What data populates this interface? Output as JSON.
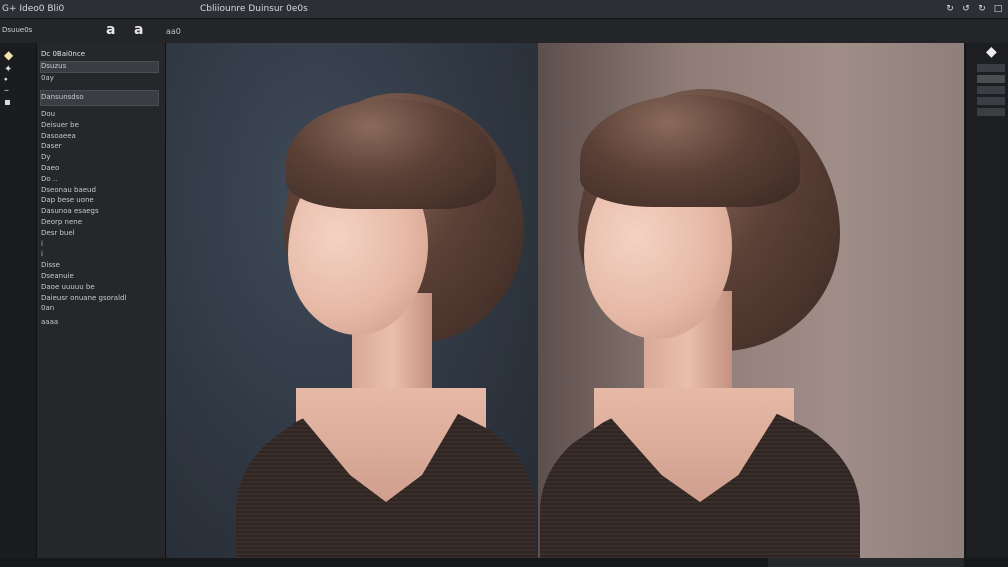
{
  "titlebar": {
    "app_title": "G+ Ideo0 Bli0",
    "document_title": "Cbliiounre Duinsur 0e0s",
    "controls": [
      "↻",
      "↺",
      "↻",
      "□"
    ]
  },
  "toolbar": {
    "left_label": "Dsuue0s",
    "tool_a": "a",
    "tool_b": "a",
    "tool_c": "aa0"
  },
  "left_panel": {
    "header": "Dc 0Bai0nce",
    "field_1": "Dsuzus",
    "row_1": "0ay",
    "field_2": "Dansunsdso",
    "lines": [
      "Dou",
      "Deisuer be",
      "Dasoaeea",
      "Daser",
      "Dy",
      "Daeo",
      "Do ..",
      "Dseonau baeud",
      "Dap bese uone",
      "Dasunoa esaegs",
      "Deorp nene",
      "Desr buel",
      "i",
      "i",
      "Disse",
      "Dseanuie",
      "Daoe uuuuu be",
      "Daieusr onuane gsoraldl",
      "0an",
      "aaaa"
    ]
  },
  "left_tools": [
    "◆",
    "✦",
    "⬩",
    "–",
    "▪"
  ],
  "right_panel": {
    "tool_icon": "◆",
    "items": [
      "",
      "",
      "",
      "",
      "",
      ""
    ]
  },
  "statusbar": {
    "items": [
      "",
      "",
      "",
      ""
    ]
  },
  "colors": {
    "titlebar_bg": "#2c2f34",
    "panel_bg": "#25272b",
    "canvas_left_bg": "#2f3742",
    "canvas_right_bg": "#8f7c77"
  }
}
